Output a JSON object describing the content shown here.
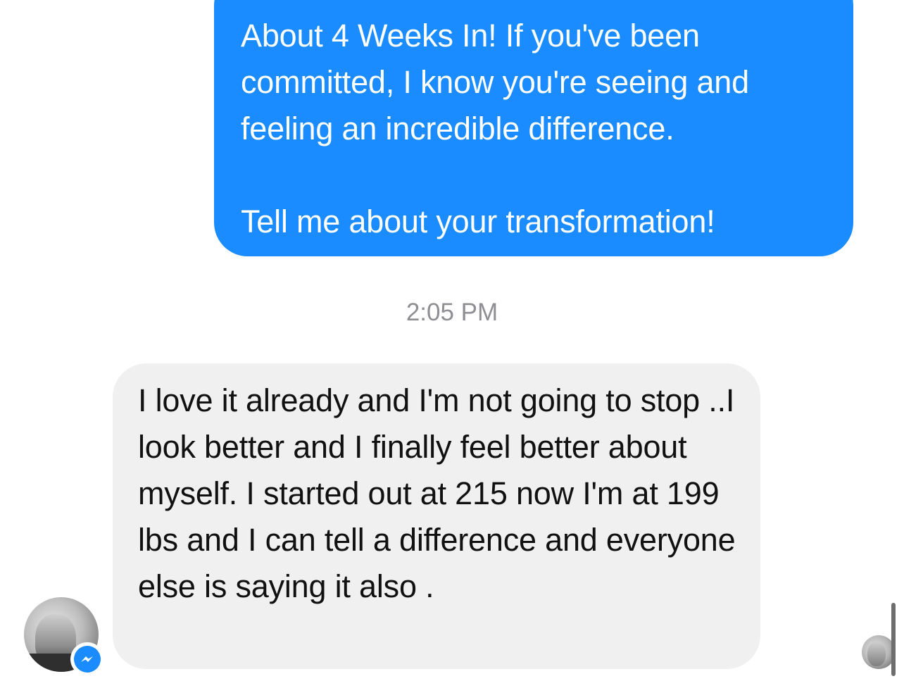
{
  "conversation": {
    "outgoing_message": {
      "paragraph_1": "About 4 Weeks In! If you've been committed, I know you're seeing and feeling an incredible difference.",
      "paragraph_2": "Tell me about your transformation!"
    },
    "timestamp": "2:05 PM",
    "incoming_message": {
      "text": "I love it already and I'm not going to stop ..I look better and I finally feel better about myself. I started out at 215 now I'm at 199 lbs and I can tell a difference and everyone else is saying it also ."
    }
  },
  "icons": {
    "sender_avatar": "avatar",
    "messenger_badge": "messenger-bolt-icon",
    "read_receipt": "read-receipt-avatar"
  },
  "colors": {
    "outgoing_bubble": "#1a8cff",
    "incoming_bubble": "#f0f0f0",
    "timestamp_text": "#8e8e93"
  }
}
